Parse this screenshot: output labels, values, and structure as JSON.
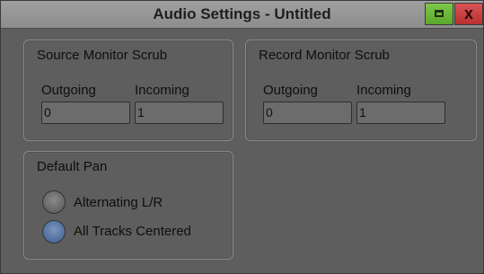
{
  "window": {
    "title": "Audio Settings - Untitled",
    "maximize_icon": "maximize-icon",
    "close_label": "x"
  },
  "source_monitor_scrub": {
    "title": "Source Monitor Scrub",
    "outgoing_label": "Outgoing",
    "incoming_label": "Incoming",
    "outgoing_value": "0",
    "incoming_value": "1"
  },
  "record_monitor_scrub": {
    "title": "Record Monitor Scrub",
    "outgoing_label": "Outgoing",
    "incoming_label": "Incoming",
    "outgoing_value": "0",
    "incoming_value": "1"
  },
  "default_pan": {
    "title": "Default Pan",
    "options": [
      {
        "label": "Alternating L/R",
        "selected": false
      },
      {
        "label": "All Tracks Centered",
        "selected": true
      }
    ]
  },
  "colors": {
    "background": "#5e5e5e",
    "titlebar": "#969696",
    "maximize_button": "#6bb83a",
    "close_button": "#c84242",
    "radio_selected": "#5b7aa8"
  }
}
